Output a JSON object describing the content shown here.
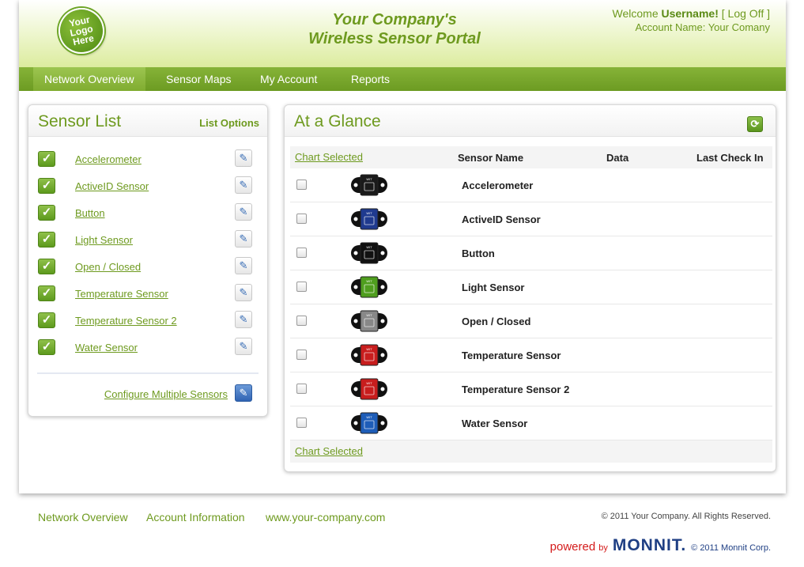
{
  "header": {
    "logo_text": "Your\nLogo\nHere",
    "title_line1": "Your Company's",
    "title_line2": "Wireless Sensor Portal",
    "welcome_prefix": "Welcome ",
    "username": "Username!",
    "logoff_label": "[ Log Off ]",
    "account_name": "Account Name: Your Comany"
  },
  "nav": {
    "tabs": [
      {
        "label": "Network Overview",
        "active": true
      },
      {
        "label": "Sensor Maps"
      },
      {
        "label": "My Account"
      },
      {
        "label": "Reports"
      }
    ]
  },
  "sensor_list": {
    "title": "Sensor List",
    "options_label": "List Options",
    "items": [
      {
        "label": "Accelerometer"
      },
      {
        "label": "ActiveID Sensor"
      },
      {
        "label": "Button"
      },
      {
        "label": "Light Sensor"
      },
      {
        "label": "Open / Closed"
      },
      {
        "label": "Temperature Sensor"
      },
      {
        "label": "Temperature Sensor 2"
      },
      {
        "label": "Water Sensor"
      }
    ],
    "configure_label": "Configure Multiple Sensors"
  },
  "glance": {
    "title": "At a Glance",
    "chart_selected_label": "Chart Selected",
    "columns": {
      "name": "Sensor Name",
      "data": "Data",
      "last_check_in": "Last Check In"
    },
    "rows": [
      {
        "name": "Accelerometer",
        "icon": "accelerometer-icon",
        "color": "#1a1a1a"
      },
      {
        "name": "ActiveID Sensor",
        "icon": "activeid-icon",
        "color": "#1f3a8f"
      },
      {
        "name": "Button",
        "icon": "button-icon",
        "color": "#111111"
      },
      {
        "name": "Light Sensor",
        "icon": "light-icon",
        "color": "#4f9e1e"
      },
      {
        "name": "Open / Closed",
        "icon": "open-closed-icon",
        "color": "#888888"
      },
      {
        "name": "Temperature Sensor",
        "icon": "temperature-icon",
        "color": "#c81d1d"
      },
      {
        "name": "Temperature Sensor 2",
        "icon": "temperature-icon",
        "color": "#c81d1d"
      },
      {
        "name": "Water Sensor",
        "icon": "water-icon",
        "color": "#1e5db8"
      }
    ]
  },
  "footer": {
    "links": [
      "Network Overview",
      "Account Information",
      "www.your-company.com"
    ],
    "copyright": "© 2011 Your Company. All Rights Reserved.",
    "powered": "powered",
    "by": "by",
    "brand": "MONNIT.",
    "brand_copyright": "© 2011 Monnit Corp."
  },
  "colors": {
    "accent": "#6e9a1f",
    "nav": "#78a72a",
    "link_blue": "#1f3f84"
  }
}
